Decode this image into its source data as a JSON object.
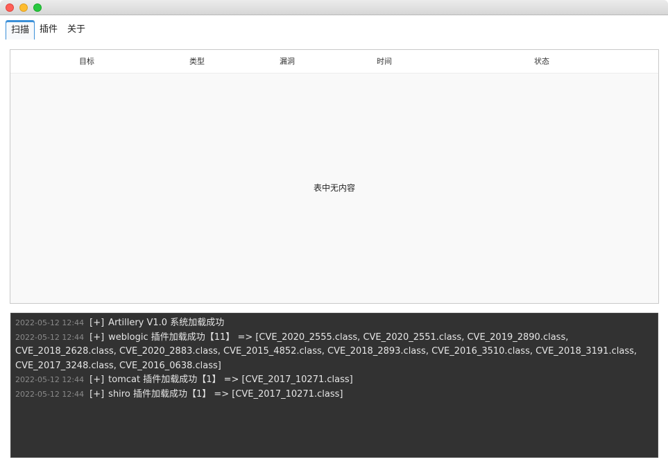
{
  "window": {
    "close_color": "#fe5f57",
    "minimize_color": "#febc2e",
    "maximize_color": "#28c840"
  },
  "tabs": [
    {
      "label": "扫描",
      "active": true
    },
    {
      "label": "插件",
      "active": false
    },
    {
      "label": "关于",
      "active": false
    }
  ],
  "table": {
    "columns": [
      "目标",
      "类型",
      "漏洞",
      "时间",
      "状态"
    ],
    "empty_text": "表中无内容"
  },
  "log": {
    "entries": [
      {
        "time": "2022-05-12 12:44",
        "tag": "[+]",
        "message": "Artillery V1.0 系统加载成功"
      },
      {
        "time": "2022-05-12 12:44",
        "tag": "[+]",
        "message": "weblogic 插件加载成功【11】 => [CVE_2020_2555.class, CVE_2020_2551.class, CVE_2019_2890.class, CVE_2018_2628.class, CVE_2020_2883.class, CVE_2015_4852.class, CVE_2018_2893.class, CVE_2016_3510.class, CVE_2018_3191.class, CVE_2017_3248.class, CVE_2016_0638.class]"
      },
      {
        "time": "2022-05-12 12:44",
        "tag": "[+]",
        "message": "tomcat 插件加载成功【1】 => [CVE_2017_10271.class]"
      },
      {
        "time": "2022-05-12 12:44",
        "tag": "[+]",
        "message": "shiro 插件加载成功【1】 => [CVE_2017_10271.class]"
      }
    ]
  }
}
